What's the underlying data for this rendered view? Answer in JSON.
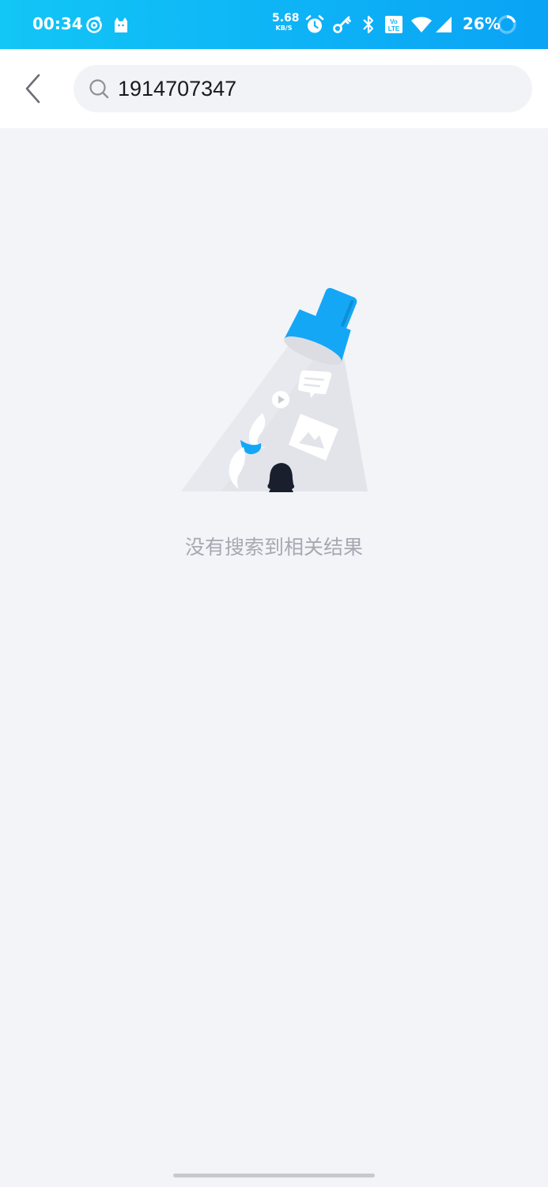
{
  "status_bar": {
    "time": "00:34",
    "icons": [
      "netease-music-icon",
      "cat-app-icon",
      "alarm-icon",
      "key-icon",
      "bluetooth-icon",
      "volte-icon",
      "wifi-icon",
      "signal-icon",
      "battery-ring-icon"
    ],
    "net_speed_value": "5.68",
    "net_speed_unit": "KB/S",
    "volte_label": "Vo LTE",
    "battery": "26%",
    "colors": {
      "gradient_start": "#12c6f6",
      "gradient_end": "#0aa3f5"
    }
  },
  "header": {
    "back_icon": "chevron-left-icon",
    "search": {
      "icon": "search-icon",
      "value": "1914707347",
      "placeholder": ""
    }
  },
  "empty_state": {
    "illustration": "flashlight-search-illustration",
    "message": "没有搜索到相关结果",
    "accent": "#14a7f5"
  }
}
